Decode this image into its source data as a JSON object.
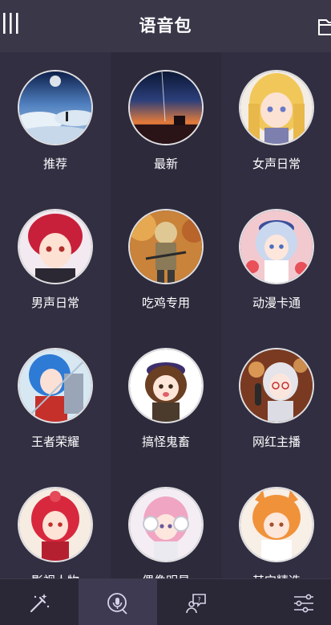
{
  "header": {
    "title": "语音包",
    "menu_icon": "menu-bars-icon",
    "folder_icon": "folder-icon"
  },
  "grid": {
    "items": [
      {
        "label": "推荐",
        "icon": "anime-sky-scene-avatar"
      },
      {
        "label": "最新",
        "icon": "sunset-sky-avatar"
      },
      {
        "label": "女声日常",
        "icon": "blonde-anime-girl-avatar"
      },
      {
        "label": "男声日常",
        "icon": "red-hair-anime-boy-avatar"
      },
      {
        "label": "吃鸡专用",
        "icon": "pubg-soldier-avatar"
      },
      {
        "label": "动漫卡通",
        "icon": "blue-hair-anime-girl-avatar"
      },
      {
        "label": "王者荣耀",
        "icon": "blue-hair-warrior-avatar"
      },
      {
        "label": "搞怪鬼畜",
        "icon": "brown-hair-cute-girl-avatar"
      },
      {
        "label": "网红主播",
        "icon": "glasses-girl-mic-avatar"
      },
      {
        "label": "影视人物",
        "icon": "red-hair-flower-girl-avatar"
      },
      {
        "label": "偶像明星",
        "icon": "pink-hair-headphone-girl-avatar"
      },
      {
        "label": "其它精选",
        "icon": "orange-hair-fox-girl-avatar"
      }
    ]
  },
  "tabbar": {
    "tabs": [
      {
        "icon": "magic-wand-icon",
        "active": false
      },
      {
        "icon": "mic-voice-icon",
        "active": true
      },
      {
        "icon": "chat-help-icon",
        "active": false
      },
      {
        "icon": "settings-sliders-icon",
        "active": false
      }
    ]
  },
  "colors": {
    "background": "#2f2c3f",
    "header": "#3a3749",
    "tabbar": "#2a2737",
    "active_tab": "#3d3a52",
    "icon": "#d8d4e8"
  }
}
